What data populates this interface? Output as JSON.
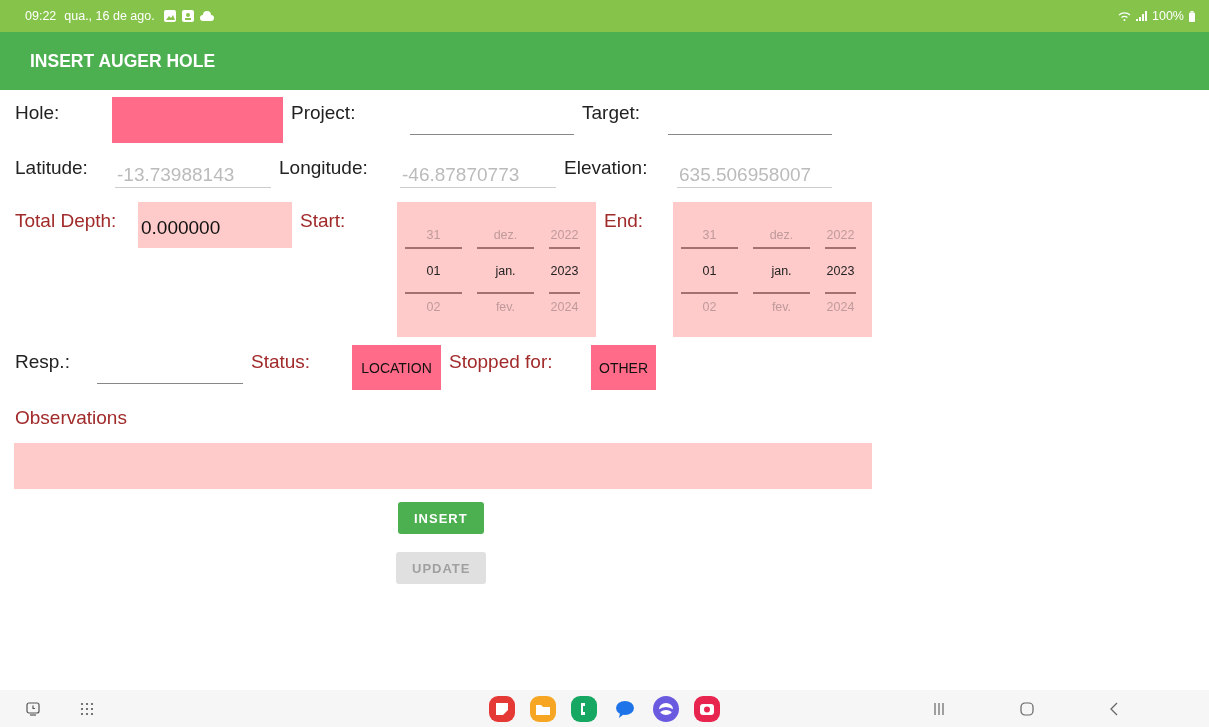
{
  "status_bar": {
    "time": "09:22",
    "date": "qua., 16 de ago.",
    "battery": "100%"
  },
  "app_bar": {
    "title": "INSERT AUGER HOLE"
  },
  "form_rows": [
    {
      "items": [
        {
          "kind": "label",
          "text": "Hole:",
          "required": false
        },
        {
          "kind": "highlight_field"
        },
        {
          "kind": "label",
          "text": "Project:",
          "required": false
        },
        {
          "kind": "underline_field"
        },
        {
          "kind": "label",
          "text": "Target:",
          "required": false
        },
        {
          "kind": "underline_field"
        }
      ]
    },
    {
      "items": [
        {
          "kind": "label",
          "text": "Latitude:",
          "required": false
        },
        {
          "kind": "underline_field",
          "placeholder": "-13.73988143"
        },
        {
          "kind": "label",
          "text": "Longitude:",
          "required": false
        },
        {
          "kind": "underline_field",
          "placeholder": "-46.87870773"
        },
        {
          "kind": "label",
          "text": "Elevation:",
          "required": false
        },
        {
          "kind": "underline_field",
          "placeholder": "635.506958007"
        }
      ]
    },
    {
      "items": [
        {
          "kind": "label",
          "text": "Total Depth:",
          "required": true
        },
        {
          "kind": "tint_field",
          "value": "0.000000"
        },
        {
          "kind": "label",
          "text": "Start:",
          "required": true
        },
        {
          "kind": "date_picker",
          "columns": [
            {
              "items": [
                {
                  "text": "31",
                  "selected": false
                },
                {
                  "text": "01",
                  "selected": true
                },
                {
                  "text": "02",
                  "selected": false
                }
              ]
            },
            {
              "items": [
                {
                  "text": "dez.",
                  "selected": false
                },
                {
                  "text": "jan.",
                  "selected": true
                },
                {
                  "text": "fev.",
                  "selected": false
                }
              ]
            },
            {
              "items": [
                {
                  "text": "2022",
                  "selected": false
                },
                {
                  "text": "2023",
                  "selected": true
                },
                {
                  "text": "2024",
                  "selected": false
                }
              ]
            }
          ]
        },
        {
          "kind": "label",
          "text": "End:",
          "required": true
        },
        {
          "kind": "date_picker",
          "columns": [
            {
              "items": [
                {
                  "text": "31",
                  "selected": false
                },
                {
                  "text": "01",
                  "selected": true
                },
                {
                  "text": "02",
                  "selected": false
                }
              ]
            },
            {
              "items": [
                {
                  "text": "dez.",
                  "selected": false
                },
                {
                  "text": "jan.",
                  "selected": true
                },
                {
                  "text": "fev.",
                  "selected": false
                }
              ]
            },
            {
              "items": [
                {
                  "text": "2022",
                  "selected": false
                },
                {
                  "text": "2023",
                  "selected": true
                },
                {
                  "text": "2024",
                  "selected": false
                }
              ]
            }
          ]
        }
      ]
    },
    {
      "items": [
        {
          "kind": "label",
          "text": "Resp.:",
          "required": false
        },
        {
          "kind": "underline_field"
        },
        {
          "kind": "label",
          "text": "Status:",
          "required": true
        },
        {
          "kind": "spinner",
          "value": "LOCATION"
        },
        {
          "kind": "label",
          "text": "Stopped for:",
          "required": true
        },
        {
          "kind": "spinner",
          "value": "OTHER"
        }
      ]
    }
  ],
  "observations": {
    "label": {
      "text": "Observations",
      "required": true
    },
    "field": {
      "kind": "tint_field"
    }
  },
  "buttons": [
    {
      "label": "INSERT",
      "disabled": false
    },
    {
      "label": "UPDATE",
      "disabled": true
    }
  ]
}
